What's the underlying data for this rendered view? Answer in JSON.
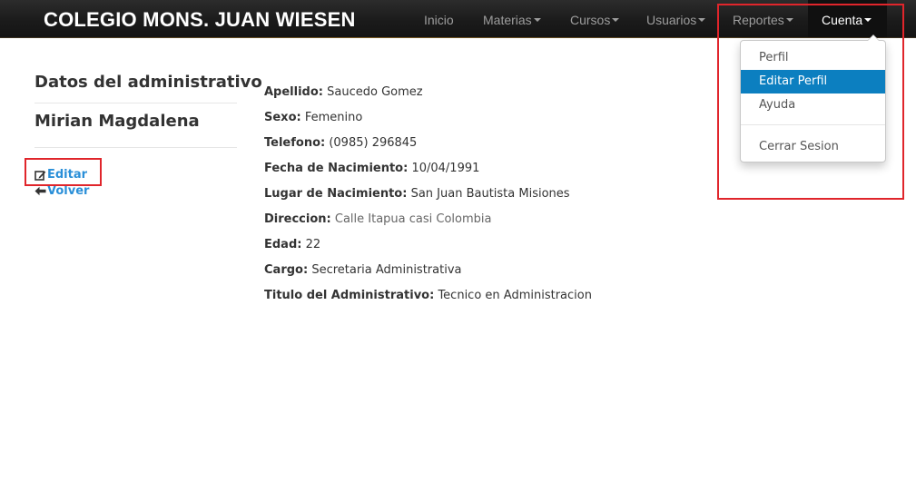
{
  "navbar": {
    "brand": "COLEGIO MONS. JUAN WIESEN",
    "items": [
      {
        "label": "Inicio"
      },
      {
        "label": "Materias"
      },
      {
        "label": "Cursos"
      },
      {
        "label": "Usuarios"
      },
      {
        "label": "Reportes"
      },
      {
        "label": "Cuenta"
      }
    ]
  },
  "dropdown": {
    "items": [
      "Perfil",
      "Editar Perfil",
      "Ayuda",
      "Cerrar Sesion"
    ],
    "active": "Editar Perfil"
  },
  "sidebar": {
    "title": "Datos del administrativo",
    "name": "Mirian Magdalena",
    "edit_label": "Editar",
    "back_label": "Volver"
  },
  "details": [
    {
      "label": "Apellido:",
      "value": "Saucedo Gomez"
    },
    {
      "label": "Sexo:",
      "value": "Femenino"
    },
    {
      "label": "Telefono:",
      "value": "(0985) 296845"
    },
    {
      "label": "Fecha de Nacimiento:",
      "value": "10/04/1991"
    },
    {
      "label": "Lugar de Nacimiento:",
      "value": "San Juan Bautista Misiones"
    },
    {
      "label": "Direccion:",
      "value": "Calle Itapua casi Colombia"
    },
    {
      "label": "Edad:",
      "value": "22"
    },
    {
      "label": "Cargo:",
      "value": "Secretaria Administrativa"
    },
    {
      "label": "Titulo del Administrativo:",
      "value": "Tecnico en Administracion"
    }
  ],
  "icons": {
    "edit": "edit-icon",
    "back": "arrow-left-icon"
  },
  "colors": {
    "link": "#2a8fd8",
    "dropdown_active": "#0c7fc0",
    "annotation": "#e0252b"
  }
}
